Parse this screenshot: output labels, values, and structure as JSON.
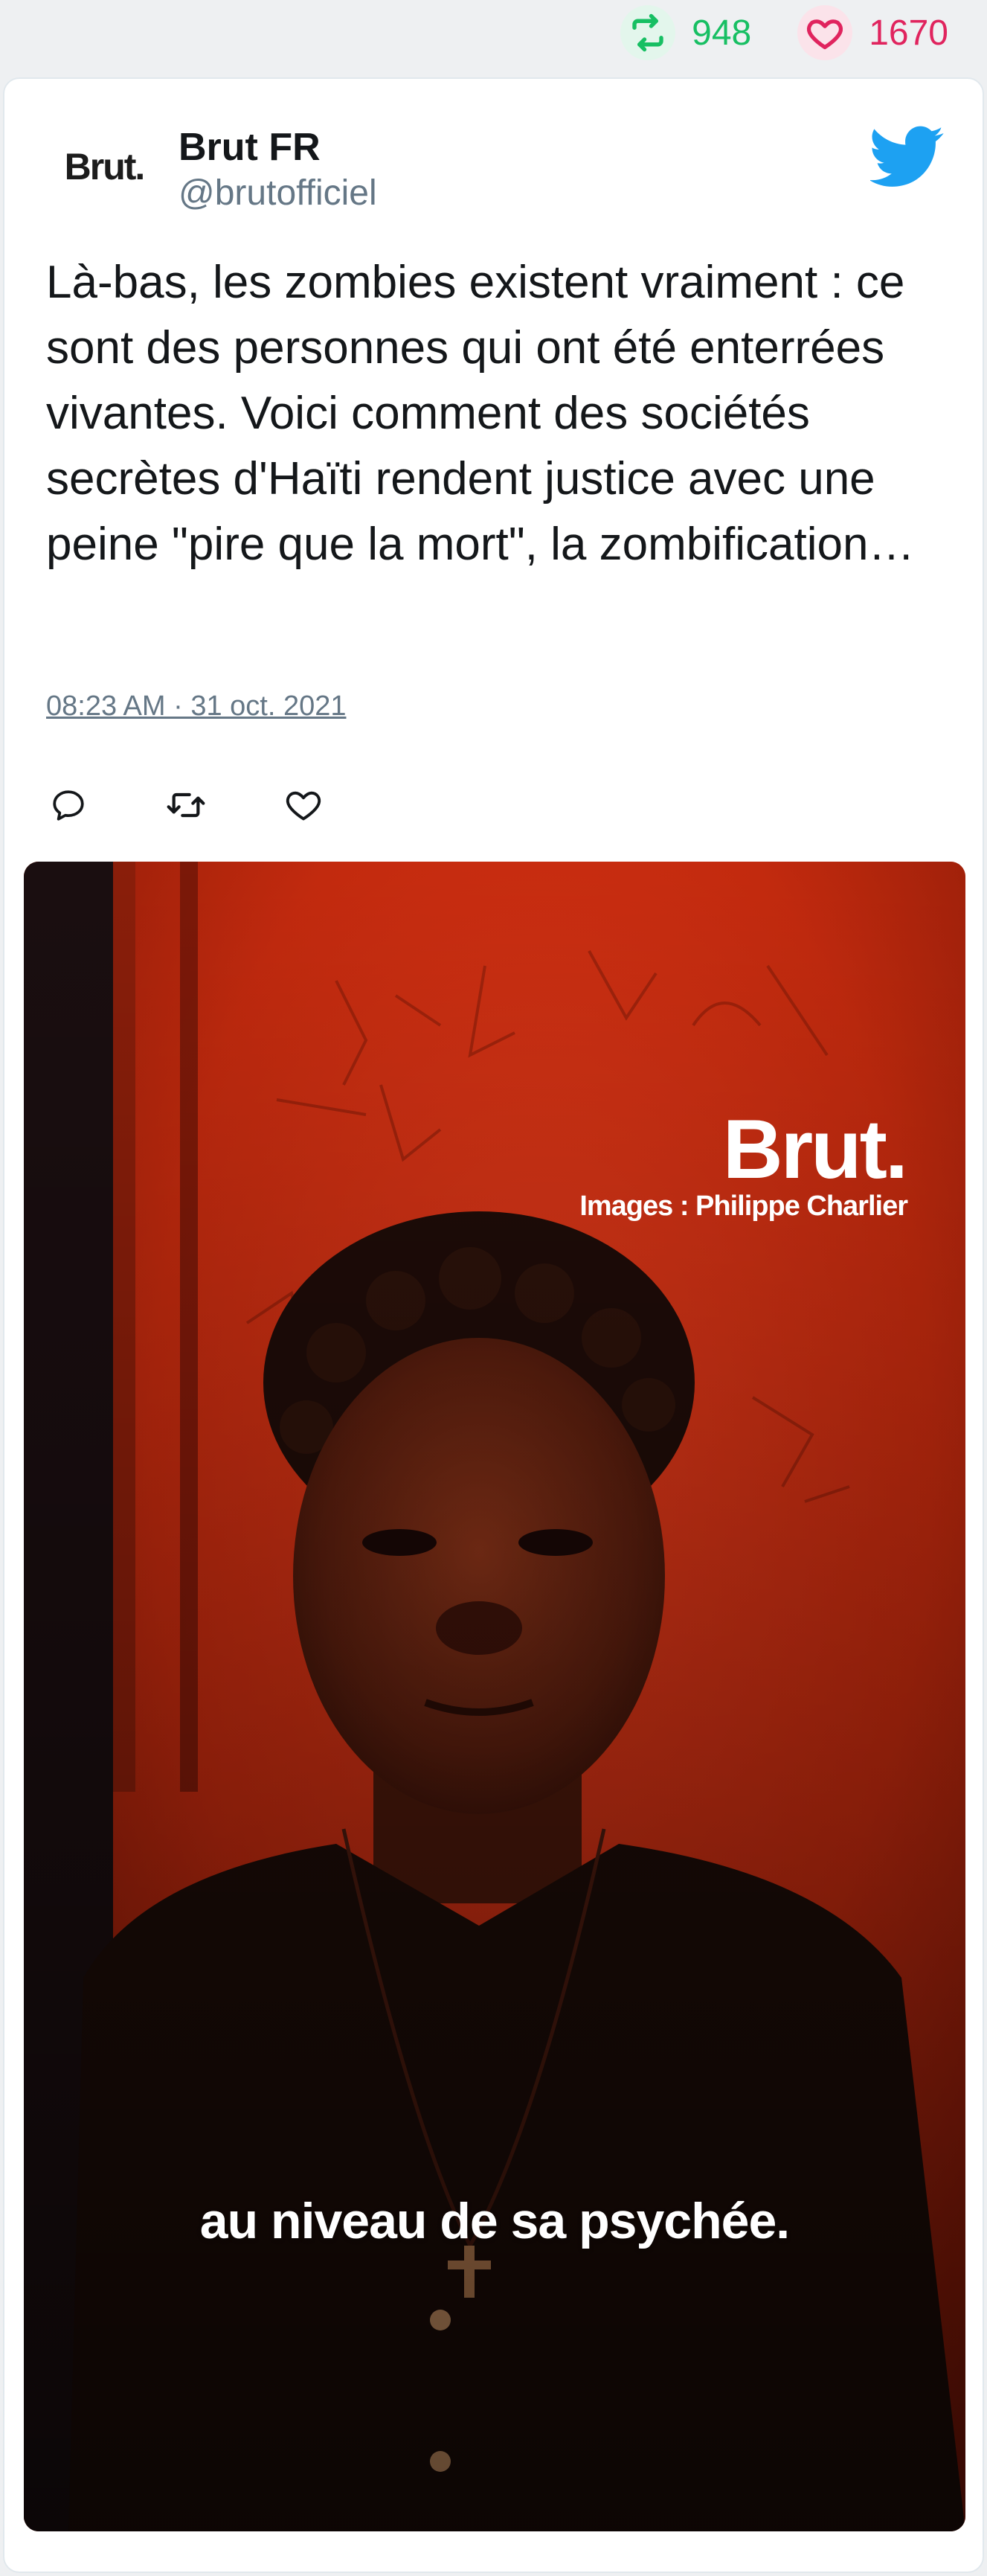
{
  "stats": {
    "retweets": "948",
    "likes": "1670",
    "retweet_color": "#17bf63",
    "like_color": "#e0245e"
  },
  "author": {
    "avatar_text": "Brut.",
    "name": "Brut FR",
    "handle": "@brutofficiel"
  },
  "tweet": {
    "text": "Là-bas, les zombies existent vraiment : ce sont des personnes qui ont été enterrées vivantes. Voici comment des sociétés secrètes d'Haïti rendent justice avec une peine \"pire que la mort\", la zombification…",
    "timestamp": "08:23 AM · 31 oct. 2021"
  },
  "icons": {
    "brand": "twitter-bird-icon",
    "actions": [
      "reply-icon",
      "retweet-icon",
      "like-icon"
    ]
  },
  "media": {
    "logo": "Brut.",
    "credit": "Images : Philippe Charlier",
    "subtitle": "au niveau de sa psychée."
  },
  "colors": {
    "twitter_blue": "#1da1f2",
    "meta_gray": "#657786"
  }
}
